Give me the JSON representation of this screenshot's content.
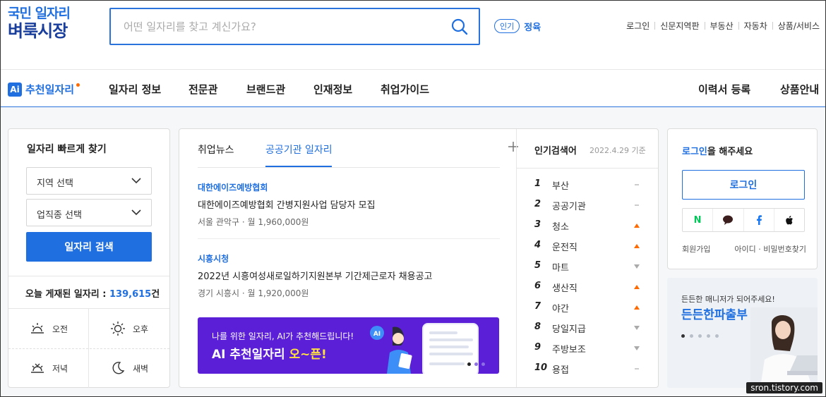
{
  "logo": {
    "line1": "국민 일자리",
    "line2": "벼룩시장"
  },
  "search": {
    "placeholder": "어떤 일자리를 찾고 계신가요?"
  },
  "popular": {
    "badge": "인기",
    "keyword": "정육"
  },
  "toplinks": [
    "로그인",
    "신문지역판",
    "부동산",
    "자동차",
    "상품/서비스"
  ],
  "nav": {
    "ai_badge": "Ai",
    "ai_label": "추천일자리",
    "items": [
      "일자리 정보",
      "전문관",
      "브랜드관",
      "인재정보",
      "취업가이드"
    ],
    "right_items": [
      "이력서 등록",
      "상품안내"
    ]
  },
  "quick": {
    "title": "일자리 빠르게 찾기",
    "region": "지역 선택",
    "job": "업직종 선택",
    "search_button": "일자리 검색",
    "count_label": "오늘 게재된 일자리 :",
    "count_value": "139,615",
    "count_unit": "건",
    "times": [
      "오전",
      "오후",
      "저녁",
      "새벽"
    ]
  },
  "news": {
    "tabs": [
      "취업뉴스",
      "공공기관 일자리"
    ],
    "items": [
      {
        "org": "대한에이즈예방협회",
        "title": "대한에이즈예방협회 간병지원사업 담당자 모집",
        "meta": "서울 관악구 · 월 1,960,000원"
      },
      {
        "org": "시흥시청",
        "title": "2022년 시흥여성새로일하기지원본부 기간제근로자 채용공고",
        "meta": "경기 시흥시 · 월 1,920,000원"
      }
    ],
    "banner": {
      "line1": "나를 위한 일자리, AI가 추천해드립니다!",
      "line2_a": "AI 추천일자리 ",
      "line2_b": "오~픈!",
      "ai_bubble": "AI"
    }
  },
  "ranking": {
    "title": "인기검색어",
    "date": "2022.4.29 기준",
    "items": [
      {
        "rank": "1",
        "term": "부산",
        "trend": "same"
      },
      {
        "rank": "2",
        "term": "공공기관",
        "trend": "same"
      },
      {
        "rank": "3",
        "term": "청소",
        "trend": "up"
      },
      {
        "rank": "4",
        "term": "운전직",
        "trend": "up"
      },
      {
        "rank": "5",
        "term": "마트",
        "trend": "down"
      },
      {
        "rank": "6",
        "term": "생산직",
        "trend": "up"
      },
      {
        "rank": "7",
        "term": "야간",
        "trend": "up"
      },
      {
        "rank": "8",
        "term": "당일지급",
        "trend": "down"
      },
      {
        "rank": "9",
        "term": "주방보조",
        "trend": "down"
      },
      {
        "rank": "10",
        "term": "용접",
        "trend": "same"
      }
    ]
  },
  "login": {
    "title_link": "로그인",
    "title_rest": "을 해주세요",
    "button": "로그인",
    "social": {
      "naver": "N"
    },
    "signup": "회원가입",
    "find": "아이디 · 비밀번호찾기"
  },
  "ad": {
    "line1": "든든한 매니저가 되어주세요!",
    "line2": "든든한파출부"
  },
  "watermark": "sron.tistory.com",
  "colors": {
    "accent": "#1f6fe0",
    "banner": "#5a1fd6",
    "up": "#ff6a00",
    "down": "#aaaaaa"
  }
}
